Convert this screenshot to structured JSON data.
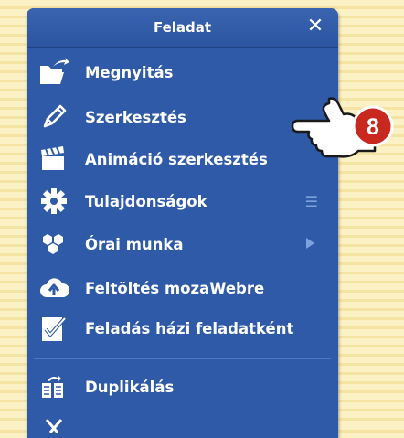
{
  "panel": {
    "title": "Feladat",
    "close_label": "✕"
  },
  "menu": {
    "items": [
      {
        "label": "Megnyitás",
        "icon": "folder-open-icon"
      },
      {
        "label": "Szerkesztés",
        "icon": "pencil-icon"
      },
      {
        "label": "Animáció szerkesztés",
        "icon": "clapperboard-icon"
      },
      {
        "label": "Tulajdonságok",
        "icon": "gear-icon",
        "side": "☰"
      },
      {
        "label": "Órai munka",
        "icon": "hexagons-icon",
        "side": "arrow"
      },
      {
        "label": "Feltöltés mozaWebre",
        "icon": "cloud-upload-icon"
      },
      {
        "label": "Feladás házi feladatként",
        "icon": "checklist-icon"
      },
      {
        "label": "Duplikálás",
        "icon": "duplicate-icon"
      }
    ]
  },
  "callout": {
    "number": "8",
    "color": "#c8281e"
  },
  "colors": {
    "panel": "#2e5aa8",
    "background": "#fbf1c4"
  }
}
